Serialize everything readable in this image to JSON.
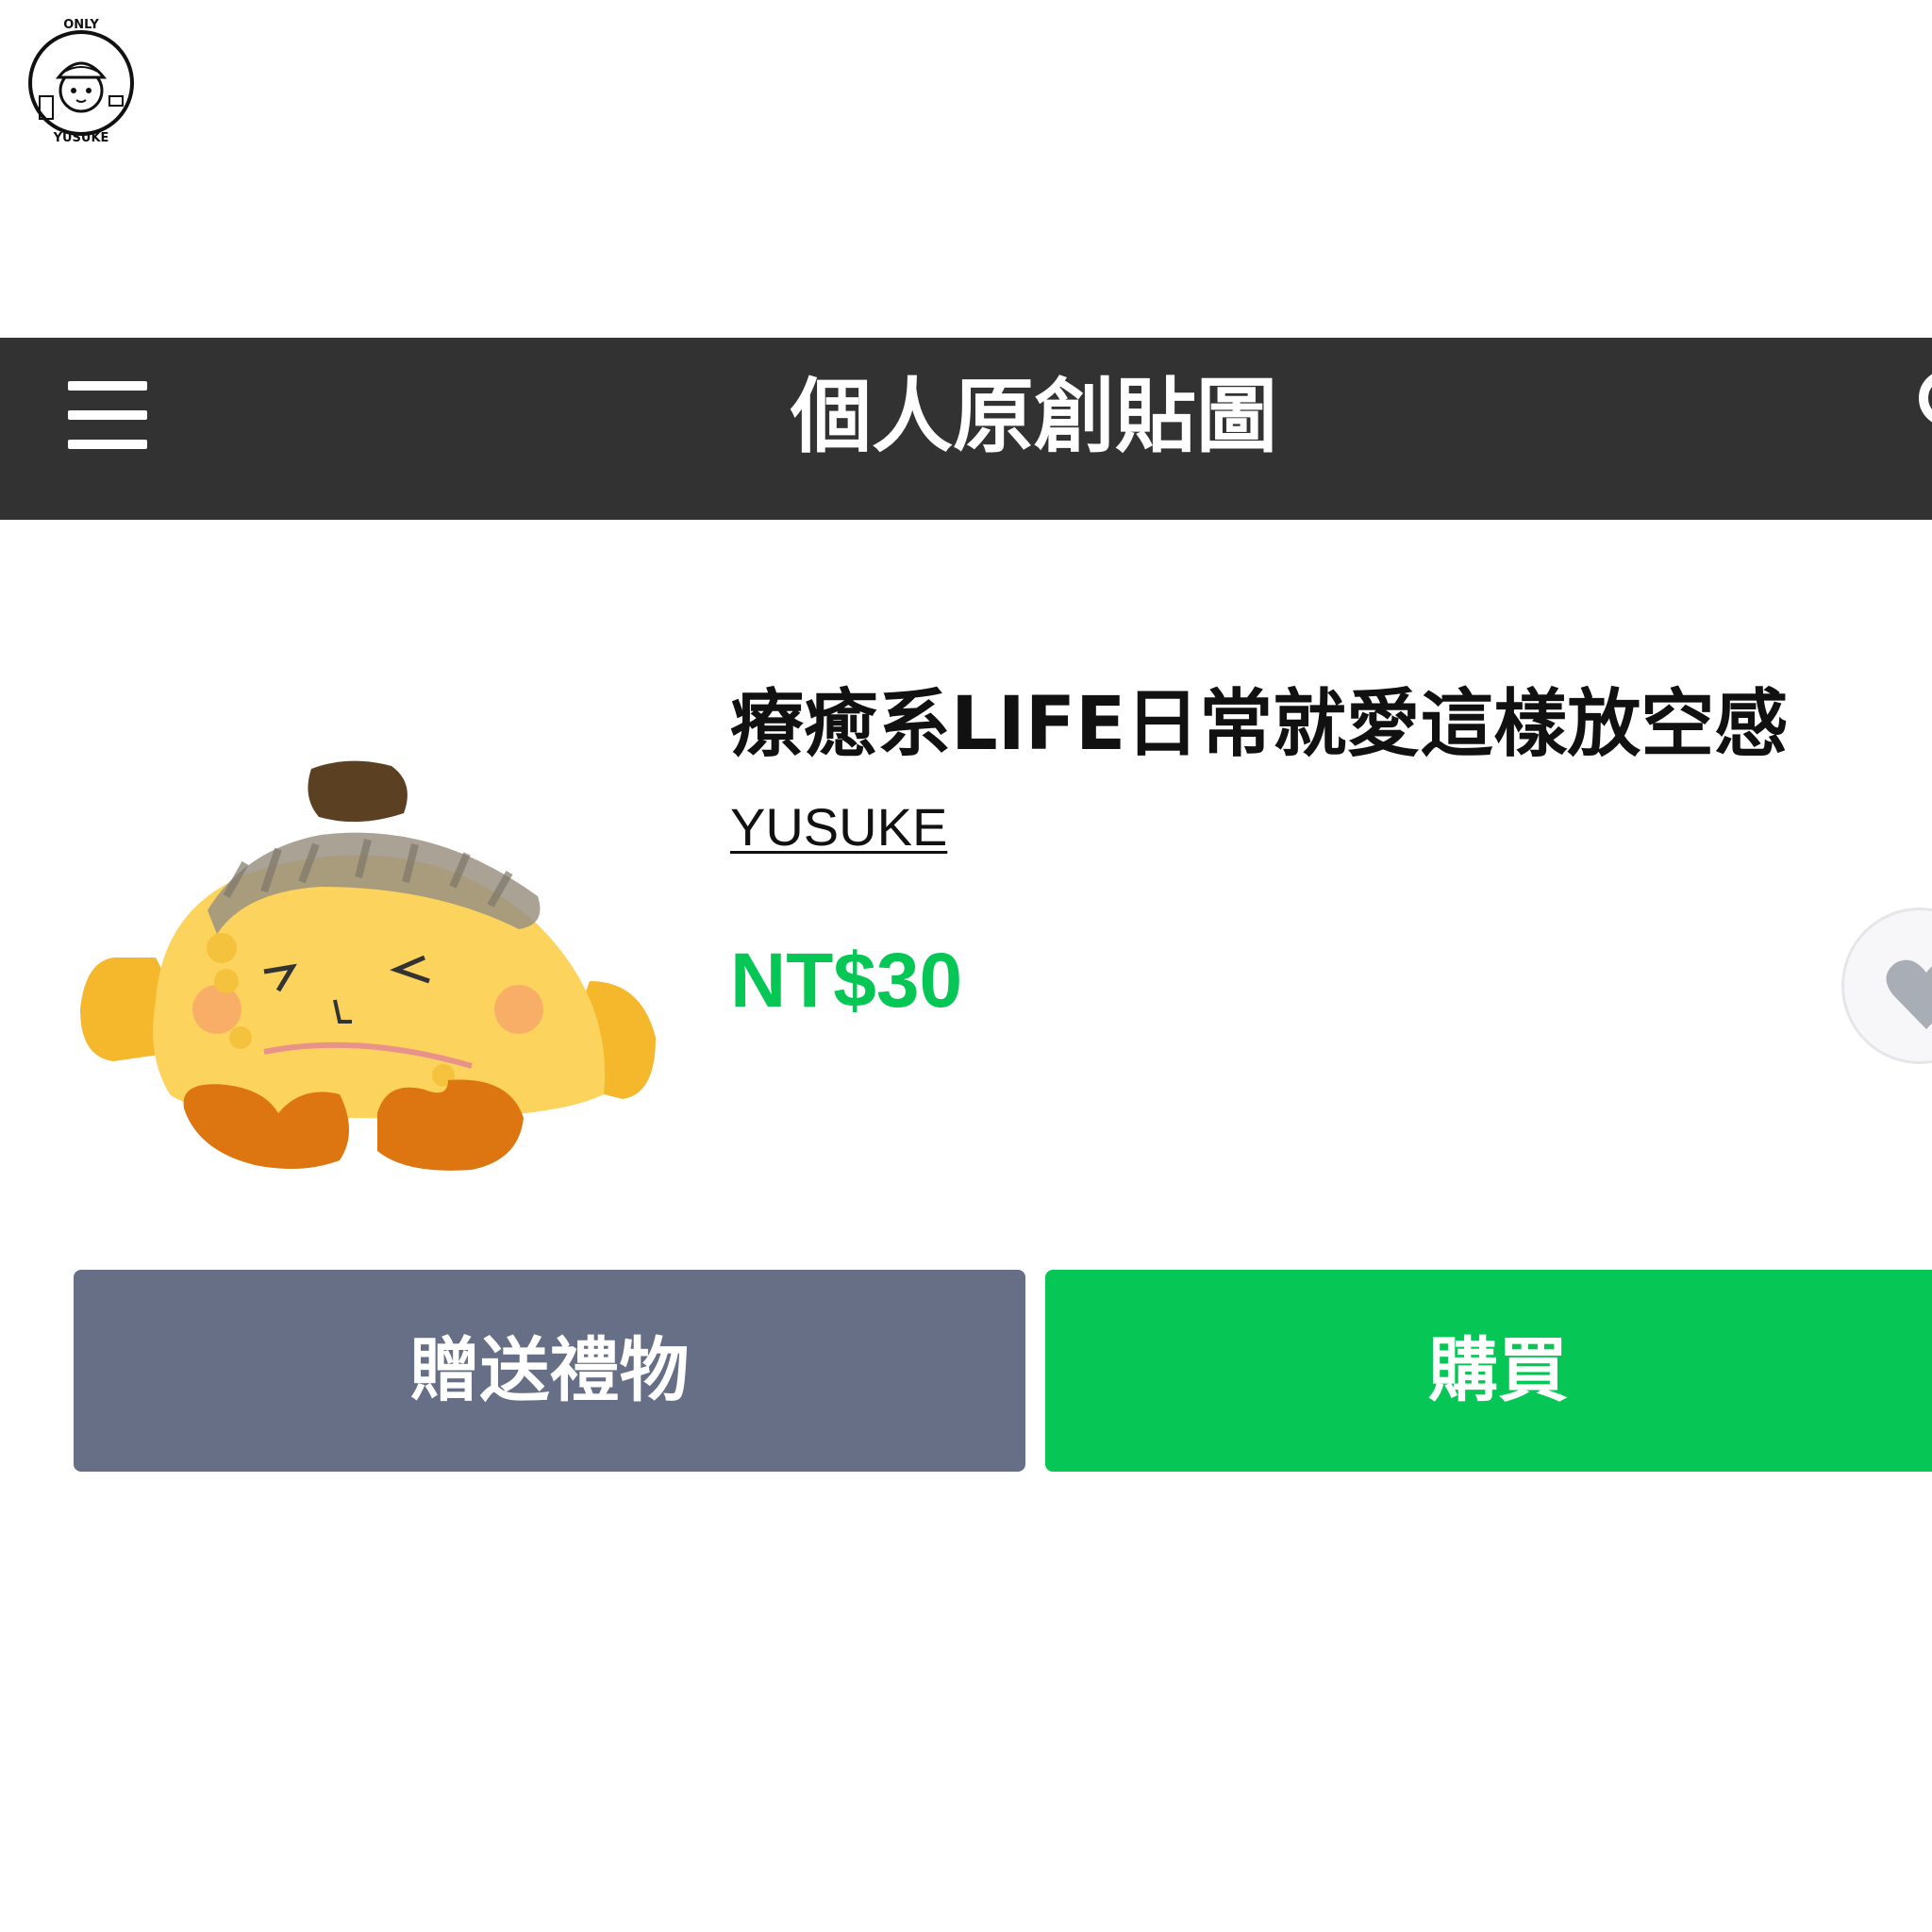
{
  "watermark": {
    "top_text": "ONLY",
    "bottom_text": "YUSUKE"
  },
  "header": {
    "title": "個人原創貼圖",
    "menu_icon": "hamburger-menu-icon",
    "search_icon": "search-icon",
    "background": "#323232"
  },
  "product": {
    "title": "療癒系LIFE日常就愛這樣放空感",
    "author": "YUSUKE",
    "price": "NT$30",
    "price_color": "#06c755",
    "favorite_icon": "heart-icon"
  },
  "actions": {
    "gift_label": "贈送禮物",
    "buy_label": "購買",
    "gift_color": "#666f86",
    "buy_color": "#06c755"
  }
}
